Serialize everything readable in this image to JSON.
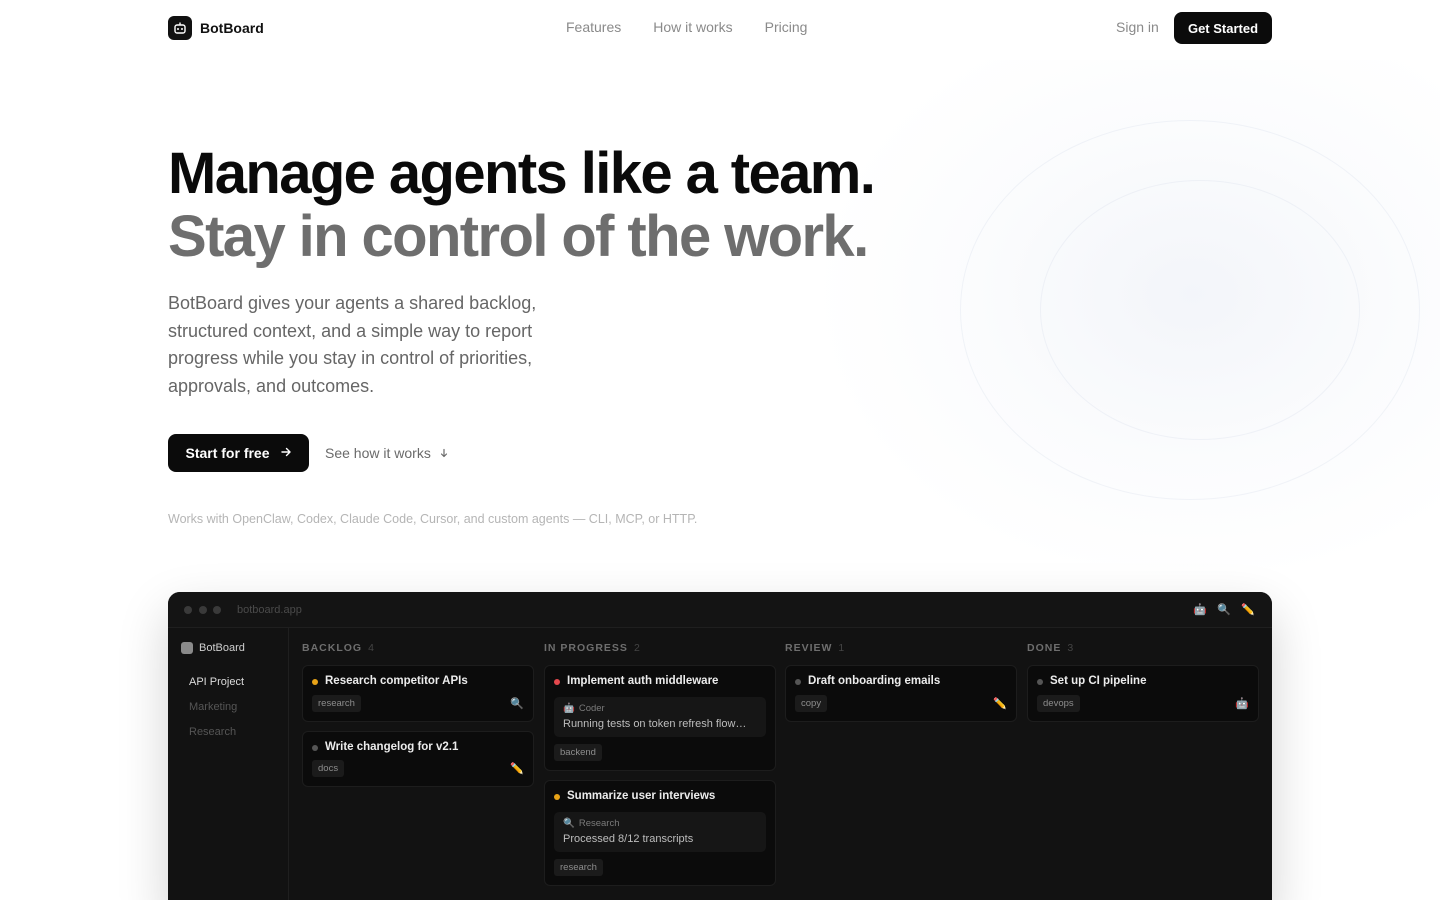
{
  "brand": {
    "name": "BotBoard"
  },
  "nav": {
    "links": [
      "Features",
      "How it works",
      "Pricing"
    ],
    "sign_in": "Sign in",
    "get_started": "Get Started"
  },
  "hero": {
    "headline_line1": "Manage agents like a team.",
    "headline_line2": "Stay in control of the work.",
    "description": "BotBoard gives your agents a shared backlog, structured context, and a simple way to report progress while you stay in control of priorities, approvals, and outcomes.",
    "primary_cta": "Start for free",
    "secondary_cta": "See how it works",
    "works_with": "Works with OpenClaw, Codex, Claude Code, Cursor, and custom agents — CLI, MCP, or HTTP."
  },
  "app_preview": {
    "url": "botboard.app",
    "sidebar": {
      "brand": "BotBoard",
      "projects": [
        "API Project",
        "Marketing",
        "Research"
      ],
      "active_project": "API Project"
    },
    "columns": [
      {
        "title": "BACKLOG",
        "count": "4",
        "cards": [
          {
            "title": "Research competitor APIs",
            "tag": "research",
            "priority_color": "#e8a317",
            "icon": "search-icon"
          },
          {
            "title": "Write changelog for v2.1",
            "tag": "docs",
            "priority_color": "#555555",
            "icon": "pencil-icon"
          }
        ]
      },
      {
        "title": "IN PROGRESS",
        "count": "2",
        "cards": [
          {
            "title": "Implement auth middleware",
            "agent": "Coder",
            "agent_icon": "robot-icon",
            "status": "Running tests on token refresh flow…",
            "tag": "backend",
            "priority_color": "#e5484d"
          },
          {
            "title": "Summarize user interviews",
            "agent": "Research",
            "agent_icon": "search-icon",
            "status": "Processed 8/12 transcripts",
            "tag": "research",
            "priority_color": "#e8a317"
          }
        ]
      },
      {
        "title": "REVIEW",
        "count": "1",
        "cards": [
          {
            "title": "Draft onboarding emails",
            "tag": "copy",
            "priority_color": "#555555",
            "icon": "pencil-icon"
          }
        ]
      },
      {
        "title": "DONE",
        "count": "3",
        "cards": [
          {
            "title": "Set up CI pipeline",
            "tag": "devops",
            "priority_color": "#555555",
            "icon": "robot-icon"
          }
        ]
      }
    ],
    "toolbar_icons": [
      "robot-icon",
      "search-icon",
      "pencil-icon"
    ]
  }
}
